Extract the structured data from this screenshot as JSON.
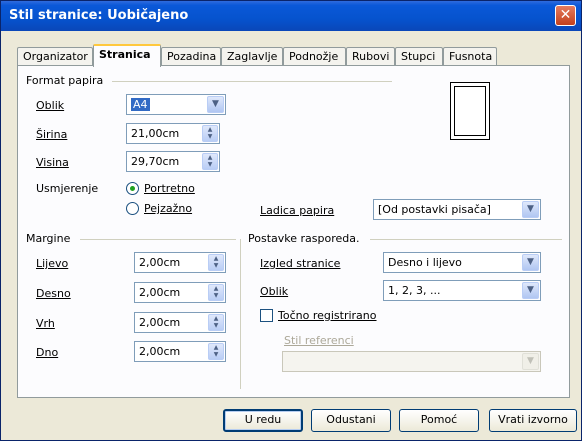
{
  "window": {
    "title": "Stil stranice: Uobičajeno",
    "close_glyph": "✕"
  },
  "tabs": [
    {
      "label": "Organizator",
      "active": false
    },
    {
      "label": "Stranica",
      "active": true
    },
    {
      "label": "Pozadina",
      "active": false
    },
    {
      "label": "Zaglavlje",
      "active": false
    },
    {
      "label": "Podnožje",
      "active": false
    },
    {
      "label": "Rubovi",
      "active": false
    },
    {
      "label": "Stupci",
      "active": false
    },
    {
      "label": "Fusnota",
      "active": false
    }
  ],
  "paper_format": {
    "group_label": "Format papira",
    "format": {
      "label": "Oblik",
      "value": "A4"
    },
    "width": {
      "label": "Širina",
      "value": "21,00cm"
    },
    "height": {
      "label": "Visina",
      "value": "29,70cm"
    },
    "orientation": {
      "label": "Usmjerenje",
      "portrait_label": "Portretno",
      "landscape_label": "Pejzažno",
      "selected": "portrait"
    },
    "paper_tray": {
      "label": "Ladica papira",
      "value": "[Od postavki pisača]"
    }
  },
  "margins": {
    "group_label": "Margine",
    "left": {
      "label": "Lijevo",
      "value": "2,00cm"
    },
    "right": {
      "label": "Desno",
      "value": "2,00cm"
    },
    "top": {
      "label": "Vrh",
      "value": "2,00cm"
    },
    "bottom": {
      "label": "Dno",
      "value": "2,00cm"
    }
  },
  "layout_settings": {
    "group_label": "Postavke rasporeda.",
    "page_layout": {
      "label": "Izgled stranice",
      "value": "Desno i lijevo"
    },
    "format": {
      "label": "Oblik",
      "value": "1, 2, 3, ..."
    },
    "register_true": {
      "label": "Točno registrirano",
      "checked": false
    },
    "reference_style": {
      "label": "Stil referenci",
      "value": ""
    }
  },
  "buttons": {
    "ok": "U redu",
    "cancel": "Odustani",
    "help": "Pomoć",
    "reset": "Vrati izvorno"
  }
}
